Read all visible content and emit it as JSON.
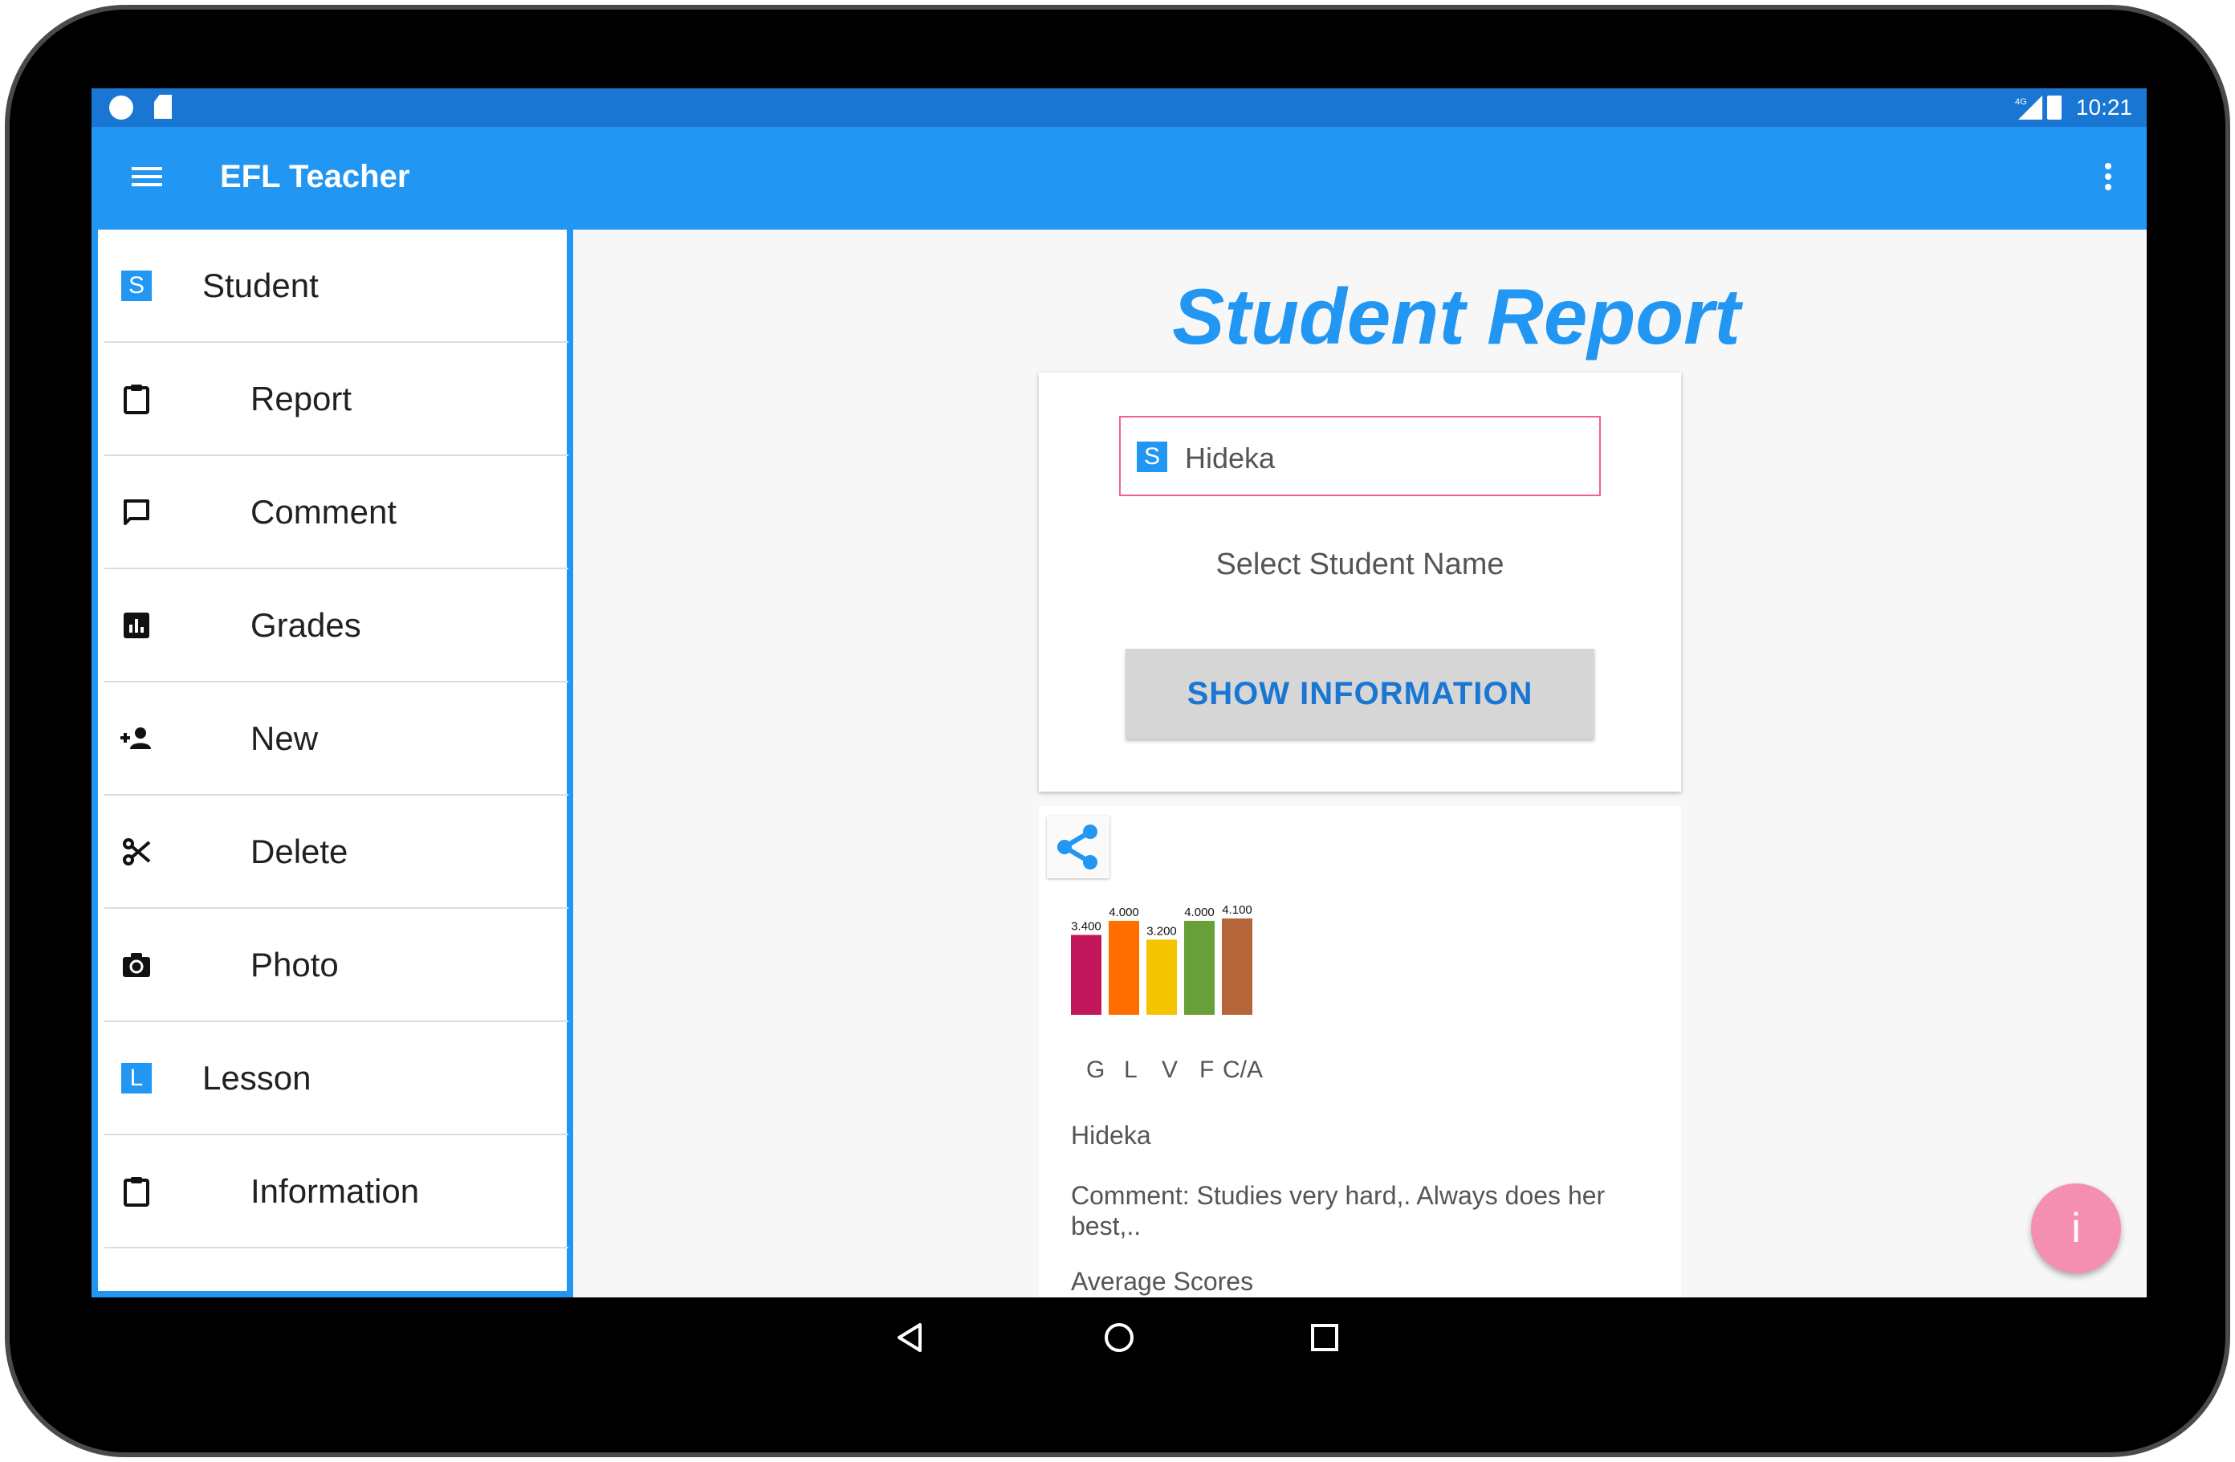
{
  "status_bar": {
    "network": "4G",
    "time": "10:21"
  },
  "app_bar": {
    "title": "EFL Teacher"
  },
  "drawer": {
    "items": [
      {
        "type": "header",
        "label": "Student",
        "badge": "S"
      },
      {
        "type": "sub",
        "label": "Report",
        "icon": "clipboard-icon"
      },
      {
        "type": "sub",
        "label": "Comment",
        "icon": "comment-icon"
      },
      {
        "type": "sub",
        "label": "Grades",
        "icon": "bar-chart-icon"
      },
      {
        "type": "sub",
        "label": "New",
        "icon": "add-person-icon"
      },
      {
        "type": "sub",
        "label": "Delete",
        "icon": "scissors-icon"
      },
      {
        "type": "sub",
        "label": "Photo",
        "icon": "camera-icon"
      },
      {
        "type": "header",
        "label": "Lesson",
        "badge": "L"
      },
      {
        "type": "sub",
        "label": "Information",
        "icon": "clipboard-icon"
      }
    ]
  },
  "main": {
    "title": "Student Report",
    "spinner": {
      "badge": "S",
      "value": "Hideka"
    },
    "hint": "Select Student Name",
    "show_button": "SHOW INFORMATION",
    "report": {
      "name": "Hideka",
      "comment": "Comment: Studies very hard,. Always does her best,..",
      "average_label": "Average Scores"
    },
    "fab_label": "i"
  },
  "colors": {
    "primary": "#2196f3",
    "primary_dark": "#1976d2",
    "accent": "#f48fb1",
    "spinner_border": "#f06292"
  },
  "chart_data": {
    "type": "bar",
    "categories": [
      "G",
      "L",
      "V",
      "F",
      "C/A"
    ],
    "values": [
      3.4,
      4.0,
      3.2,
      4.0,
      4.1
    ],
    "value_labels": [
      "3.400",
      "4.000",
      "3.200",
      "4.000",
      "4.100"
    ],
    "colors": [
      "#c2185b",
      "#ff6f00",
      "#f5c400",
      "#689f38",
      "#b5653a"
    ],
    "ylim": [
      0,
      4.1
    ],
    "grid": false,
    "legend": "none"
  }
}
